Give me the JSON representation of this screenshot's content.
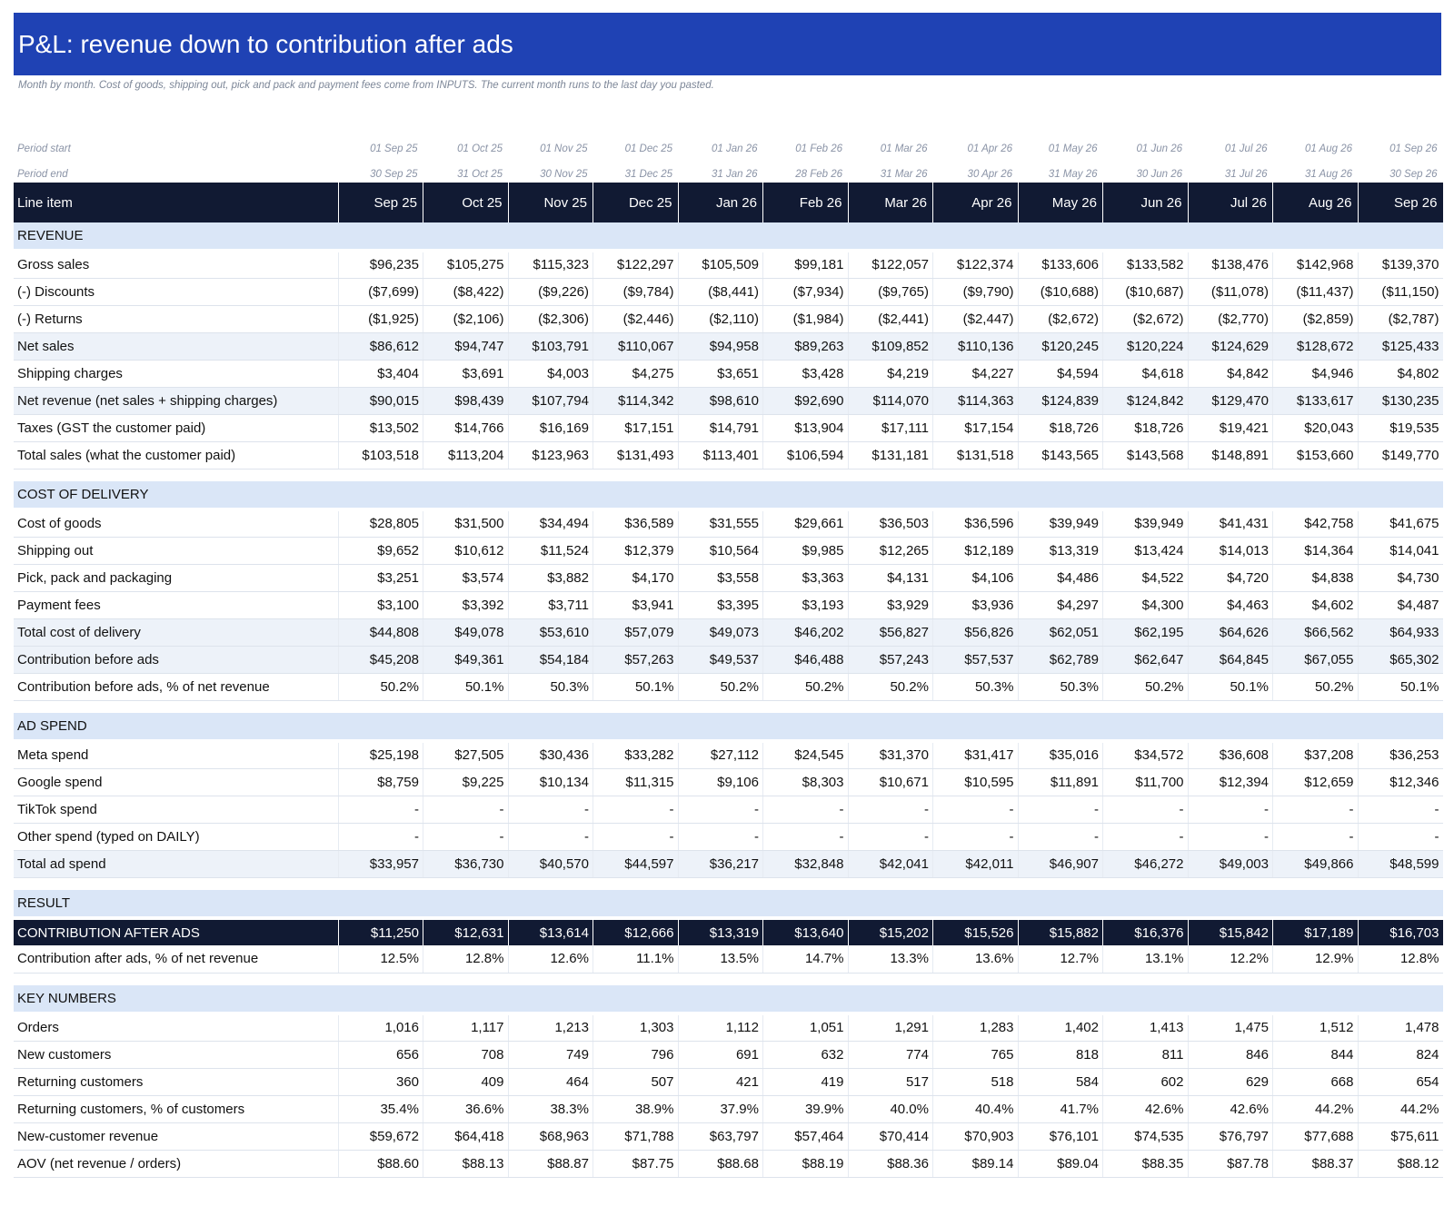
{
  "title": "P&L: revenue down to contribution after ads",
  "subtitle": "Month by month. Cost of goods, shipping out, pick and pack and payment fees come from INPUTS. The current month runs to the last day you pasted.",
  "period_start_label": "Period start",
  "period_end_label": "Period end",
  "period_starts": [
    "01 Sep 25",
    "01 Oct 25",
    "01 Nov 25",
    "01 Dec 25",
    "01 Jan 26",
    "01 Feb 26",
    "01 Mar 26",
    "01 Apr 26",
    "01 May 26",
    "01 Jun 26",
    "01 Jul 26",
    "01 Aug 26",
    "01 Sep 26"
  ],
  "period_ends": [
    "30 Sep 25",
    "31 Oct 25",
    "30 Nov 25",
    "31 Dec 25",
    "31 Jan 26",
    "28 Feb 26",
    "31 Mar 26",
    "30 Apr 26",
    "31 May 26",
    "30 Jun 26",
    "31 Jul 26",
    "31 Aug 26",
    "30 Sep 26"
  ],
  "header_label": "Line item",
  "months": [
    "Sep 25",
    "Oct 25",
    "Nov 25",
    "Dec 25",
    "Jan 26",
    "Feb 26",
    "Mar 26",
    "Apr 26",
    "May 26",
    "Jun 26",
    "Jul 26",
    "Aug 26",
    "Sep 26"
  ],
  "sections": [
    {
      "title": "REVENUE",
      "rows": [
        {
          "label": "Gross sales",
          "style": "plain",
          "values": [
            "$96,235",
            "$105,275",
            "$115,323",
            "$122,297",
            "$105,509",
            "$99,181",
            "$122,057",
            "$122,374",
            "$133,606",
            "$133,582",
            "$138,476",
            "$142,968",
            "$139,370"
          ]
        },
        {
          "label": "(-) Discounts",
          "style": "plain",
          "values": [
            "($7,699)",
            "($8,422)",
            "($9,226)",
            "($9,784)",
            "($8,441)",
            "($7,934)",
            "($9,765)",
            "($9,790)",
            "($10,688)",
            "($10,687)",
            "($11,078)",
            "($11,437)",
            "($11,150)"
          ]
        },
        {
          "label": "(-) Returns",
          "style": "plain",
          "values": [
            "($1,925)",
            "($2,106)",
            "($2,306)",
            "($2,446)",
            "($2,110)",
            "($1,984)",
            "($2,441)",
            "($2,447)",
            "($2,672)",
            "($2,672)",
            "($2,770)",
            "($2,859)",
            "($2,787)"
          ]
        },
        {
          "label": "Net sales",
          "style": "alt",
          "values": [
            "$86,612",
            "$94,747",
            "$103,791",
            "$110,067",
            "$94,958",
            "$89,263",
            "$109,852",
            "$110,136",
            "$120,245",
            "$120,224",
            "$124,629",
            "$128,672",
            "$125,433"
          ]
        },
        {
          "label": "Shipping charges",
          "style": "plain",
          "values": [
            "$3,404",
            "$3,691",
            "$4,003",
            "$4,275",
            "$3,651",
            "$3,428",
            "$4,219",
            "$4,227",
            "$4,594",
            "$4,618",
            "$4,842",
            "$4,946",
            "$4,802"
          ]
        },
        {
          "label": "Net revenue (net sales + shipping charges)",
          "style": "alt",
          "values": [
            "$90,015",
            "$98,439",
            "$107,794",
            "$114,342",
            "$98,610",
            "$92,690",
            "$114,070",
            "$114,363",
            "$124,839",
            "$124,842",
            "$129,470",
            "$133,617",
            "$130,235"
          ]
        },
        {
          "label": "Taxes (GST the customer paid)",
          "style": "plain",
          "values": [
            "$13,502",
            "$14,766",
            "$16,169",
            "$17,151",
            "$14,791",
            "$13,904",
            "$17,111",
            "$17,154",
            "$18,726",
            "$18,726",
            "$19,421",
            "$20,043",
            "$19,535"
          ]
        },
        {
          "label": "Total sales (what the customer paid)",
          "style": "plain",
          "values": [
            "$103,518",
            "$113,204",
            "$123,963",
            "$131,493",
            "$113,401",
            "$106,594",
            "$131,181",
            "$131,518",
            "$143,565",
            "$143,568",
            "$148,891",
            "$153,660",
            "$149,770"
          ]
        }
      ]
    },
    {
      "title": "COST OF DELIVERY",
      "rows": [
        {
          "label": "Cost of goods",
          "style": "plain",
          "values": [
            "$28,805",
            "$31,500",
            "$34,494",
            "$36,589",
            "$31,555",
            "$29,661",
            "$36,503",
            "$36,596",
            "$39,949",
            "$39,949",
            "$41,431",
            "$42,758",
            "$41,675"
          ]
        },
        {
          "label": "Shipping out",
          "style": "plain",
          "values": [
            "$9,652",
            "$10,612",
            "$11,524",
            "$12,379",
            "$10,564",
            "$9,985",
            "$12,265",
            "$12,189",
            "$13,319",
            "$13,424",
            "$14,013",
            "$14,364",
            "$14,041"
          ]
        },
        {
          "label": "Pick, pack and packaging",
          "style": "plain",
          "values": [
            "$3,251",
            "$3,574",
            "$3,882",
            "$4,170",
            "$3,558",
            "$3,363",
            "$4,131",
            "$4,106",
            "$4,486",
            "$4,522",
            "$4,720",
            "$4,838",
            "$4,730"
          ]
        },
        {
          "label": "Payment fees",
          "style": "plain",
          "values": [
            "$3,100",
            "$3,392",
            "$3,711",
            "$3,941",
            "$3,395",
            "$3,193",
            "$3,929",
            "$3,936",
            "$4,297",
            "$4,300",
            "$4,463",
            "$4,602",
            "$4,487"
          ]
        },
        {
          "label": "Total cost of delivery",
          "style": "alt",
          "values": [
            "$44,808",
            "$49,078",
            "$53,610",
            "$57,079",
            "$49,073",
            "$46,202",
            "$56,827",
            "$56,826",
            "$62,051",
            "$62,195",
            "$64,626",
            "$66,562",
            "$64,933"
          ]
        },
        {
          "label": "Contribution before ads",
          "style": "alt",
          "values": [
            "$45,208",
            "$49,361",
            "$54,184",
            "$57,263",
            "$49,537",
            "$46,488",
            "$57,243",
            "$57,537",
            "$62,789",
            "$62,647",
            "$64,845",
            "$67,055",
            "$65,302"
          ]
        },
        {
          "label": "Contribution before ads, % of net revenue",
          "style": "plain",
          "values": [
            "50.2%",
            "50.1%",
            "50.3%",
            "50.1%",
            "50.2%",
            "50.2%",
            "50.2%",
            "50.3%",
            "50.3%",
            "50.2%",
            "50.1%",
            "50.2%",
            "50.1%"
          ]
        }
      ]
    },
    {
      "title": "AD SPEND",
      "rows": [
        {
          "label": "Meta spend",
          "style": "plain",
          "values": [
            "$25,198",
            "$27,505",
            "$30,436",
            "$33,282",
            "$27,112",
            "$24,545",
            "$31,370",
            "$31,417",
            "$35,016",
            "$34,572",
            "$36,608",
            "$37,208",
            "$36,253"
          ]
        },
        {
          "label": "Google spend",
          "style": "plain",
          "values": [
            "$8,759",
            "$9,225",
            "$10,134",
            "$11,315",
            "$9,106",
            "$8,303",
            "$10,671",
            "$10,595",
            "$11,891",
            "$11,700",
            "$12,394",
            "$12,659",
            "$12,346"
          ]
        },
        {
          "label": "TikTok spend",
          "style": "plain",
          "values": [
            "-",
            "-",
            "-",
            "-",
            "-",
            "-",
            "-",
            "-",
            "-",
            "-",
            "-",
            "-",
            "-"
          ]
        },
        {
          "label": "Other spend (typed on DAILY)",
          "style": "plain",
          "values": [
            "-",
            "-",
            "-",
            "-",
            "-",
            "-",
            "-",
            "-",
            "-",
            "-",
            "-",
            "-",
            "-"
          ]
        },
        {
          "label": "Total ad spend",
          "style": "alt",
          "values": [
            "$33,957",
            "$36,730",
            "$40,570",
            "$44,597",
            "$36,217",
            "$32,848",
            "$42,041",
            "$42,011",
            "$46,907",
            "$46,272",
            "$49,003",
            "$49,866",
            "$48,599"
          ]
        }
      ]
    },
    {
      "title": "RESULT",
      "rows": [
        {
          "label": "CONTRIBUTION AFTER ADS",
          "style": "result",
          "values": [
            "$11,250",
            "$12,631",
            "$13,614",
            "$12,666",
            "$13,319",
            "$13,640",
            "$15,202",
            "$15,526",
            "$15,882",
            "$16,376",
            "$15,842",
            "$17,189",
            "$16,703"
          ]
        },
        {
          "label": "Contribution after ads, % of net revenue",
          "style": "plain",
          "values": [
            "12.5%",
            "12.8%",
            "12.6%",
            "11.1%",
            "13.5%",
            "14.7%",
            "13.3%",
            "13.6%",
            "12.7%",
            "13.1%",
            "12.2%",
            "12.9%",
            "12.8%"
          ]
        }
      ]
    },
    {
      "title": "KEY NUMBERS",
      "rows": [
        {
          "label": "Orders",
          "style": "plain",
          "values": [
            "1,016",
            "1,117",
            "1,213",
            "1,303",
            "1,112",
            "1,051",
            "1,291",
            "1,283",
            "1,402",
            "1,413",
            "1,475",
            "1,512",
            "1,478"
          ]
        },
        {
          "label": "New customers",
          "style": "plain",
          "values": [
            "656",
            "708",
            "749",
            "796",
            "691",
            "632",
            "774",
            "765",
            "818",
            "811",
            "846",
            "844",
            "824"
          ]
        },
        {
          "label": "Returning customers",
          "style": "plain",
          "values": [
            "360",
            "409",
            "464",
            "507",
            "421",
            "419",
            "517",
            "518",
            "584",
            "602",
            "629",
            "668",
            "654"
          ]
        },
        {
          "label": "Returning customers, % of customers",
          "style": "plain",
          "values": [
            "35.4%",
            "36.6%",
            "38.3%",
            "38.9%",
            "37.9%",
            "39.9%",
            "40.0%",
            "40.4%",
            "41.7%",
            "42.6%",
            "42.6%",
            "44.2%",
            "44.2%"
          ]
        },
        {
          "label": "New-customer revenue",
          "style": "plain",
          "values": [
            "$59,672",
            "$64,418",
            "$68,963",
            "$71,788",
            "$63,797",
            "$57,464",
            "$70,414",
            "$70,903",
            "$76,101",
            "$74,535",
            "$76,797",
            "$77,688",
            "$75,611"
          ]
        },
        {
          "label": "AOV (net revenue / orders)",
          "style": "plain",
          "values": [
            "$88.60",
            "$88.13",
            "$88.87",
            "$87.75",
            "$88.68",
            "$88.19",
            "$88.36",
            "$89.14",
            "$89.04",
            "$88.35",
            "$87.78",
            "$88.37",
            "$88.12"
          ]
        }
      ]
    }
  ],
  "colors": {
    "banner": "#1f42b4",
    "header": "#111a33",
    "section": "#dae6f7",
    "alt_row": "#edf2f9"
  }
}
